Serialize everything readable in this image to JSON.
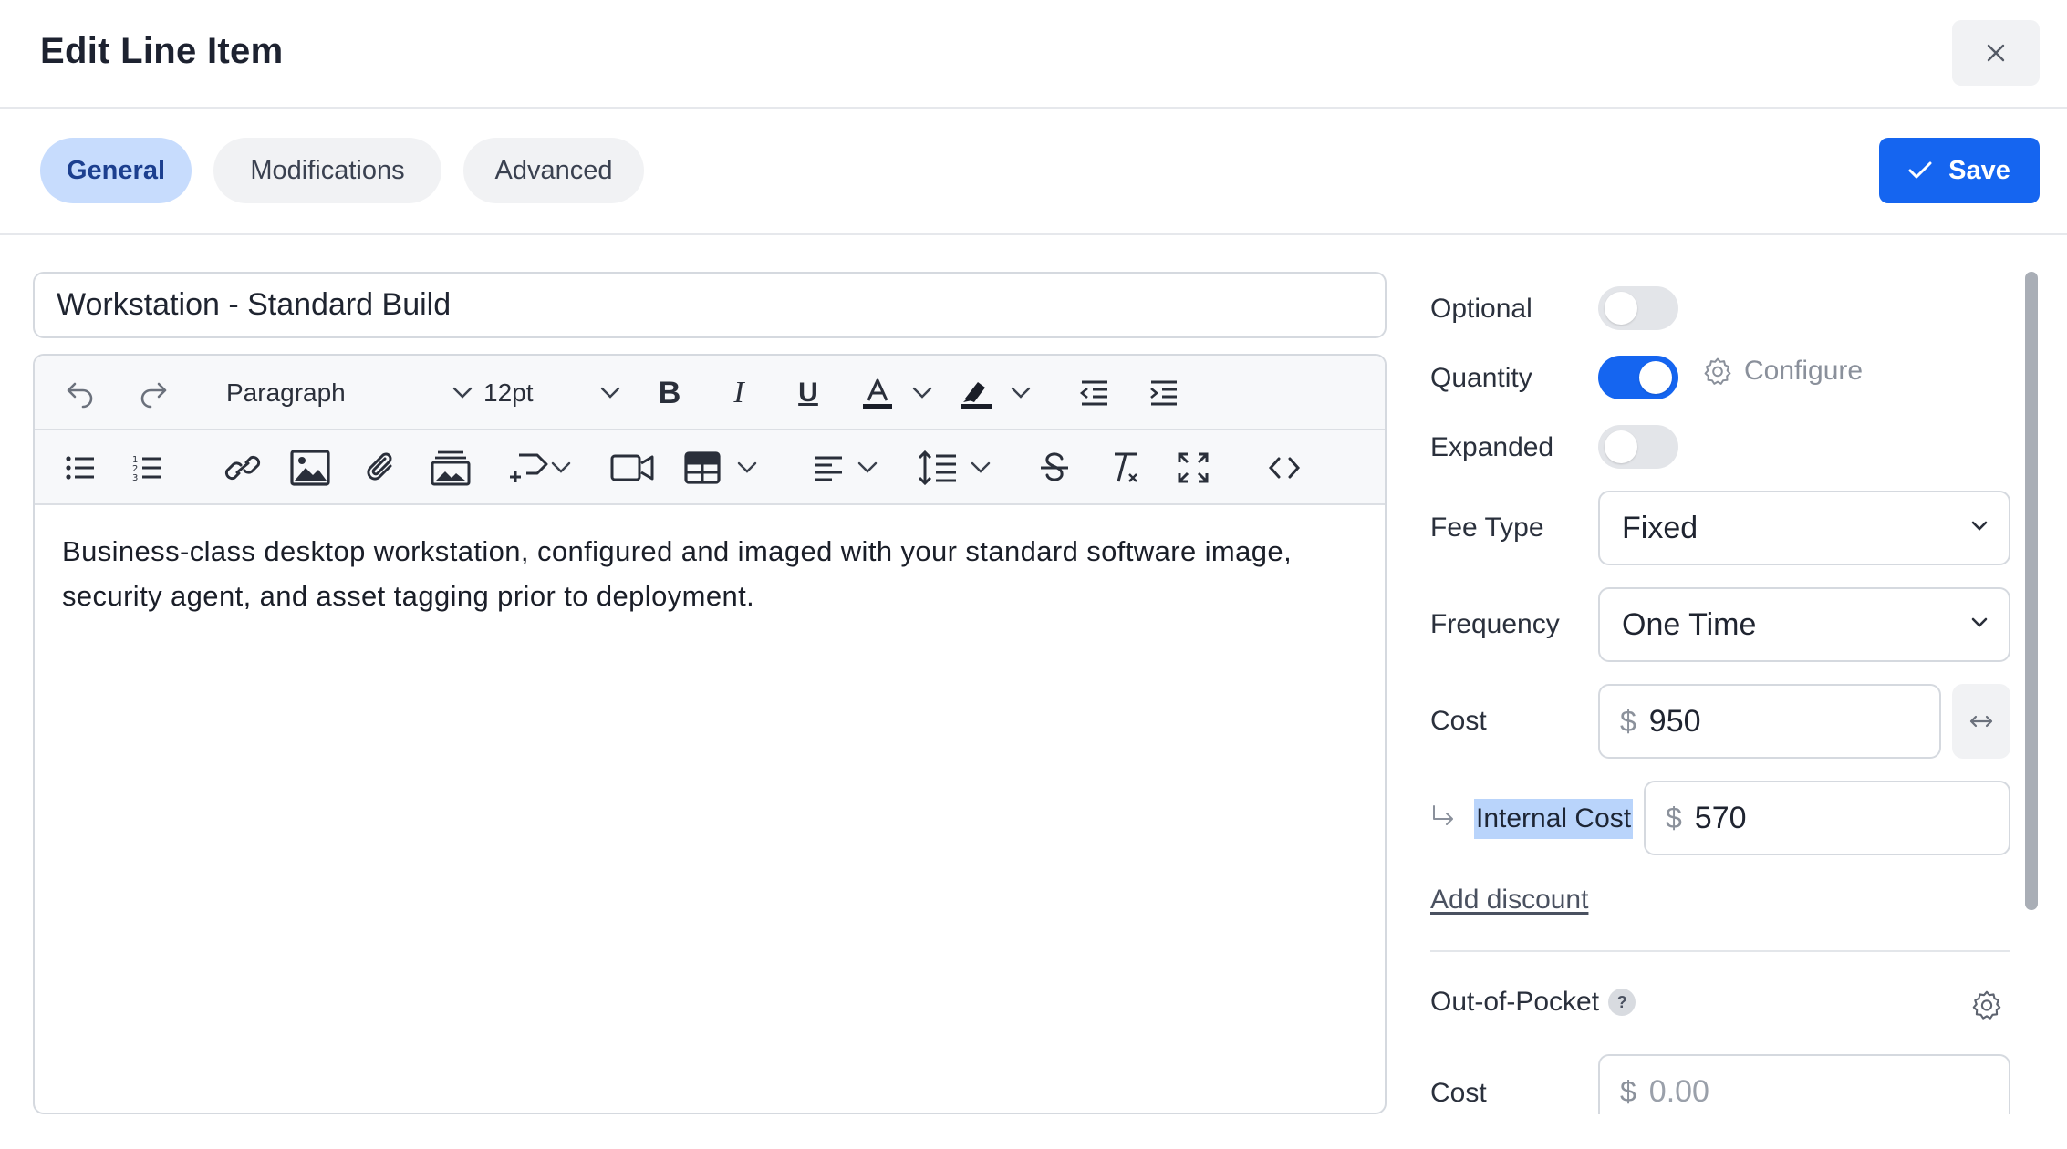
{
  "dialog": {
    "title": "Edit Line Item"
  },
  "tabs": [
    {
      "label": "General",
      "active": true
    },
    {
      "label": "Modifications",
      "active": false
    },
    {
      "label": "Advanced",
      "active": false
    }
  ],
  "actions": {
    "save_label": "Save"
  },
  "item": {
    "name": "Workstation - Standard Build"
  },
  "editor": {
    "block_format": "Paragraph",
    "font_size": "12pt",
    "body": "Business-class desktop workstation, configured and imaged with your standard software image, security agent, and asset tagging prior to deployment."
  },
  "settings": {
    "optional": {
      "label": "Optional",
      "on": false
    },
    "quantity": {
      "label": "Quantity",
      "on": true,
      "configure_label": "Configure"
    },
    "expanded": {
      "label": "Expanded",
      "on": false
    },
    "fee_type": {
      "label": "Fee Type",
      "value": "Fixed"
    },
    "frequency": {
      "label": "Frequency",
      "value": "One Time"
    },
    "cost": {
      "label": "Cost",
      "currency": "$",
      "value": "950"
    },
    "internal_cost": {
      "label": "Internal Cost",
      "currency": "$",
      "value": "570"
    },
    "add_discount": "Add discount",
    "out_of_pocket": {
      "label": "Out-of-Pocket",
      "help": "?"
    },
    "oop_cost": {
      "label": "Cost",
      "currency": "$",
      "placeholder": "0.00"
    }
  },
  "colors": {
    "accent": "#1565f0",
    "active_tab_bg": "#c7dcfd",
    "highlight": "#b9d4fb"
  }
}
